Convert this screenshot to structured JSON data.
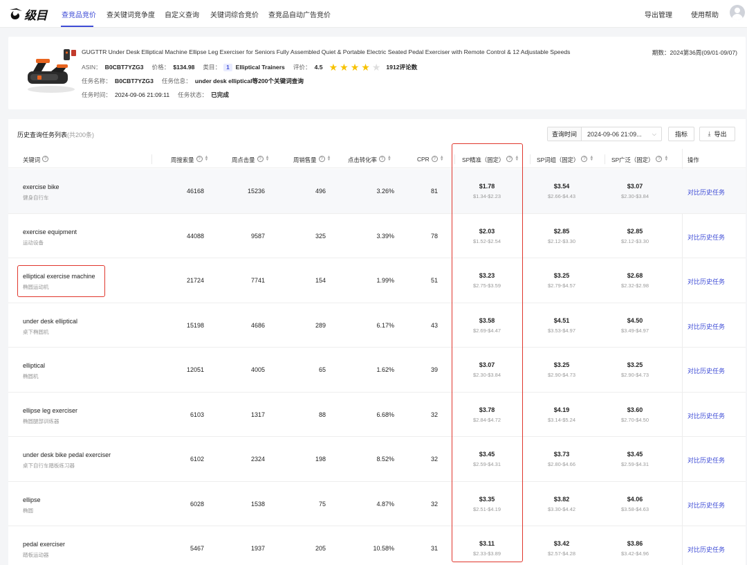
{
  "nav": {
    "logo_text": "级目",
    "tabs": [
      "查竞品竞价",
      "查关键词竞争度",
      "自定义查询",
      "关键词综合竞价",
      "查竞品自动广告竞价"
    ],
    "active_tab": 0,
    "right": [
      "导出管理",
      "使用帮助"
    ]
  },
  "product": {
    "title": "GUGTTR Under Desk Elliptical Machine Ellipse Leg Exerciser for Seniors Fully Assembled Quiet & Portable Electric Seated Pedal Exerciser with Remote Control & 12 Adjustable Speeds",
    "period_label": "期数：",
    "period_value": "2024第36周(09/01-09/07)",
    "asin_label": "ASIN：",
    "asin": "B0CBT7YZG3",
    "price_label": "价格：",
    "price": "$134.98",
    "category_label": "类目：",
    "category_rank": "1",
    "category": "Elliptical Trainers",
    "rating_label": "评价：",
    "rating": "4.5",
    "stars_full": 4,
    "stars_total": 5,
    "reviews": "1912评论数",
    "task_name_label": "任务名称：",
    "task_name": "B0CBT7YZG3",
    "task_info_label": "任务信息：",
    "task_info_prefix": "under desk elliptical等",
    "task_info_count": "200",
    "task_info_suffix": "个关键词查询",
    "task_time_label": "任务时间：",
    "task_time": "2024-09-06 21:09:11",
    "task_status_label": "任务状态：",
    "task_status": "已完成"
  },
  "panel": {
    "title": "历史查询任务列表",
    "count": "(共200条)",
    "query_time_label": "查询时间",
    "query_time_value": "2024-09-06 21:09...",
    "metric_button": "指标",
    "export_button": "导出"
  },
  "table": {
    "headers": [
      "关键词",
      "周搜索量",
      "周点击量",
      "周销售量",
      "点击转化率",
      "CPR",
      "SP精准（固定）",
      "SP词组（固定）",
      "SP广泛（固定）",
      "操作"
    ],
    "action_label": "对比历史任务",
    "rows": [
      {
        "kw": "exercise bike",
        "cn": "健身自行车",
        "search": "46168",
        "clicks": "15236",
        "sales": "496",
        "cvr": "3.26%",
        "cpr": "81",
        "exact": "$1.78",
        "exact_range": "$1.34-$2.23",
        "phrase": "$3.54",
        "phrase_range": "$2.66-$4.43",
        "broad": "$3.07",
        "broad_range": "$2.30-$3.84"
      },
      {
        "kw": "exercise equipment",
        "cn": "运动设备",
        "search": "44088",
        "clicks": "9587",
        "sales": "325",
        "cvr": "3.39%",
        "cpr": "78",
        "exact": "$2.03",
        "exact_range": "$1.52-$2.54",
        "phrase": "$2.85",
        "phrase_range": "$2.12-$3.30",
        "broad": "$2.85",
        "broad_range": "$2.12-$3.30"
      },
      {
        "kw": "elliptical exercise machine",
        "cn": "椭圆运动机",
        "search": "21724",
        "clicks": "7741",
        "sales": "154",
        "cvr": "1.99%",
        "cpr": "51",
        "exact": "$3.23",
        "exact_range": "$2.75-$3.59",
        "phrase": "$3.25",
        "phrase_range": "$2.79-$4.57",
        "broad": "$2.68",
        "broad_range": "$2.32-$2.98"
      },
      {
        "kw": "under desk elliptical",
        "cn": "桌下椭圆机",
        "search": "15198",
        "clicks": "4686",
        "sales": "289",
        "cvr": "6.17%",
        "cpr": "43",
        "exact": "$3.58",
        "exact_range": "$2.69-$4.47",
        "phrase": "$4.51",
        "phrase_range": "$3.53-$4.97",
        "broad": "$4.50",
        "broad_range": "$3.49-$4.97"
      },
      {
        "kw": "elliptical",
        "cn": "椭圆机",
        "search": "12051",
        "clicks": "4005",
        "sales": "65",
        "cvr": "1.62%",
        "cpr": "39",
        "exact": "$3.07",
        "exact_range": "$2.30-$3.84",
        "phrase": "$3.25",
        "phrase_range": "$2.90-$4.73",
        "broad": "$3.25",
        "broad_range": "$2.90-$4.73"
      },
      {
        "kw": "ellipse leg exerciser",
        "cn": "椭圆腿部训练器",
        "search": "6103",
        "clicks": "1317",
        "sales": "88",
        "cvr": "6.68%",
        "cpr": "32",
        "exact": "$3.78",
        "exact_range": "$2.84-$4.72",
        "phrase": "$4.19",
        "phrase_range": "$3.14-$5.24",
        "broad": "$3.60",
        "broad_range": "$2.70-$4.50"
      },
      {
        "kw": "under desk bike pedal exerciser",
        "cn": "桌下自行车踏板练习器",
        "search": "6102",
        "clicks": "2324",
        "sales": "198",
        "cvr": "8.52%",
        "cpr": "32",
        "exact": "$3.45",
        "exact_range": "$2.59-$4.31",
        "phrase": "$3.73",
        "phrase_range": "$2.80-$4.66",
        "broad": "$3.45",
        "broad_range": "$2.59-$4.31"
      },
      {
        "kw": "ellipse",
        "cn": "椭圆",
        "search": "6028",
        "clicks": "1538",
        "sales": "75",
        "cvr": "4.87%",
        "cpr": "32",
        "exact": "$3.35",
        "exact_range": "$2.51-$4.19",
        "phrase": "$3.82",
        "phrase_range": "$3.30-$4.42",
        "broad": "$4.06",
        "broad_range": "$3.58-$4.63"
      },
      {
        "kw": "pedal exerciser",
        "cn": "踏板运动器",
        "search": "5467",
        "clicks": "1937",
        "sales": "205",
        "cvr": "10.58%",
        "cpr": "31",
        "exact": "$3.11",
        "exact_range": "$2.33-$3.89",
        "phrase": "$3.42",
        "phrase_range": "$2.57-$4.28",
        "broad": "$3.86",
        "broad_range": "$3.42-$4.96"
      }
    ]
  },
  "colors": {
    "accent": "#3d4bd6",
    "annotation": "#e0352b",
    "star": "#f7c200"
  }
}
